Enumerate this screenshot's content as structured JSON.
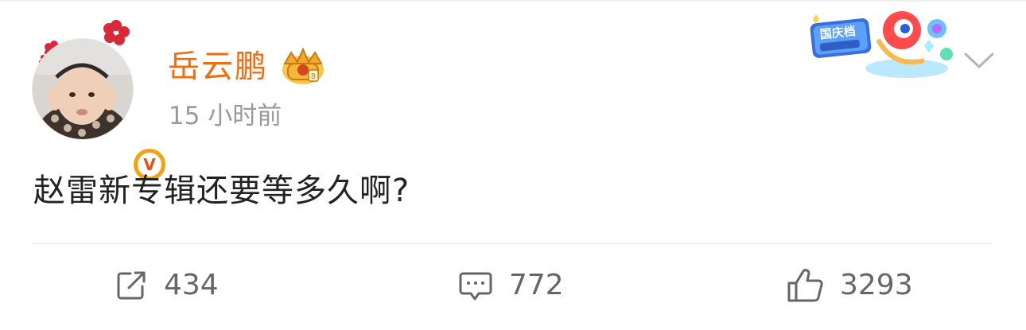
{
  "post": {
    "user": {
      "name": "岳云鹏",
      "verified_badge": "V",
      "badge_icon": "crown-vip-icon"
    },
    "time": "15 小时前",
    "text": "赵雷新专辑还要等多久啊?",
    "promo_banner": {
      "label": "国庆档",
      "icon": "mascot-promo-icon"
    }
  },
  "actions": {
    "repost": {
      "icon": "repost-icon",
      "count": "434"
    },
    "comment": {
      "icon": "comment-icon",
      "count": "772"
    },
    "like": {
      "icon": "thumbs-up-icon",
      "count": "3293"
    }
  },
  "colors": {
    "username": "#f26b0f",
    "time": "#9a9a9a",
    "content": "#222222",
    "count": "#666666",
    "badge": "#f4a20f"
  }
}
